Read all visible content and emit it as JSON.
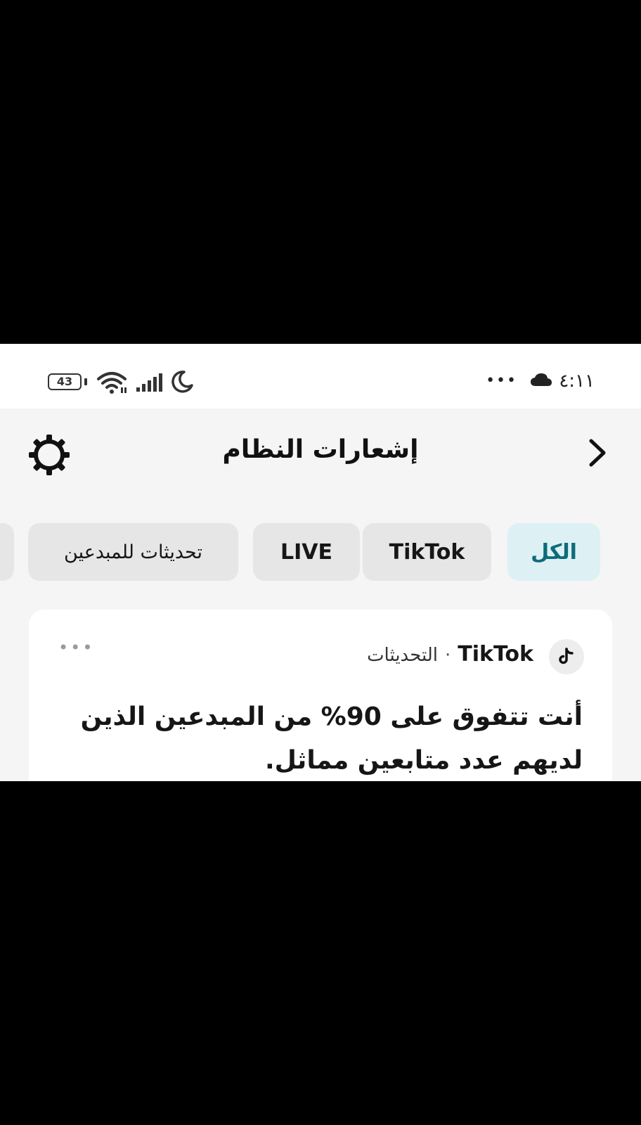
{
  "status_bar": {
    "time": "٤:١١",
    "dots": "•••",
    "battery": "43",
    "icons": [
      "cloud-icon",
      "wifi-icon",
      "signal-icon",
      "moon-icon",
      "battery-icon"
    ]
  },
  "header": {
    "title": "إشعارات النظام",
    "back_icon": "chevron-right-icon",
    "settings_icon": "gear-icon"
  },
  "tabs": [
    {
      "label": "الكل",
      "active": true
    },
    {
      "label": "TikTok",
      "active": false
    },
    {
      "label": "LIVE",
      "active": false
    },
    {
      "label": "تحديثات للمبدعين",
      "active": false
    }
  ],
  "notification": {
    "source": "TikTok",
    "separator": "·",
    "category": "التحديثات",
    "more": "•••",
    "body": "أنت تتفوق على 90% من المبدعين الذين لديهم عدد متابعين مماثل."
  },
  "colors": {
    "active_tab_bg": "#ddf1f4",
    "active_tab_text": "#0e6b7a",
    "tab_bg": "#e6e6e6",
    "screen_bg": "#f5f5f5"
  }
}
